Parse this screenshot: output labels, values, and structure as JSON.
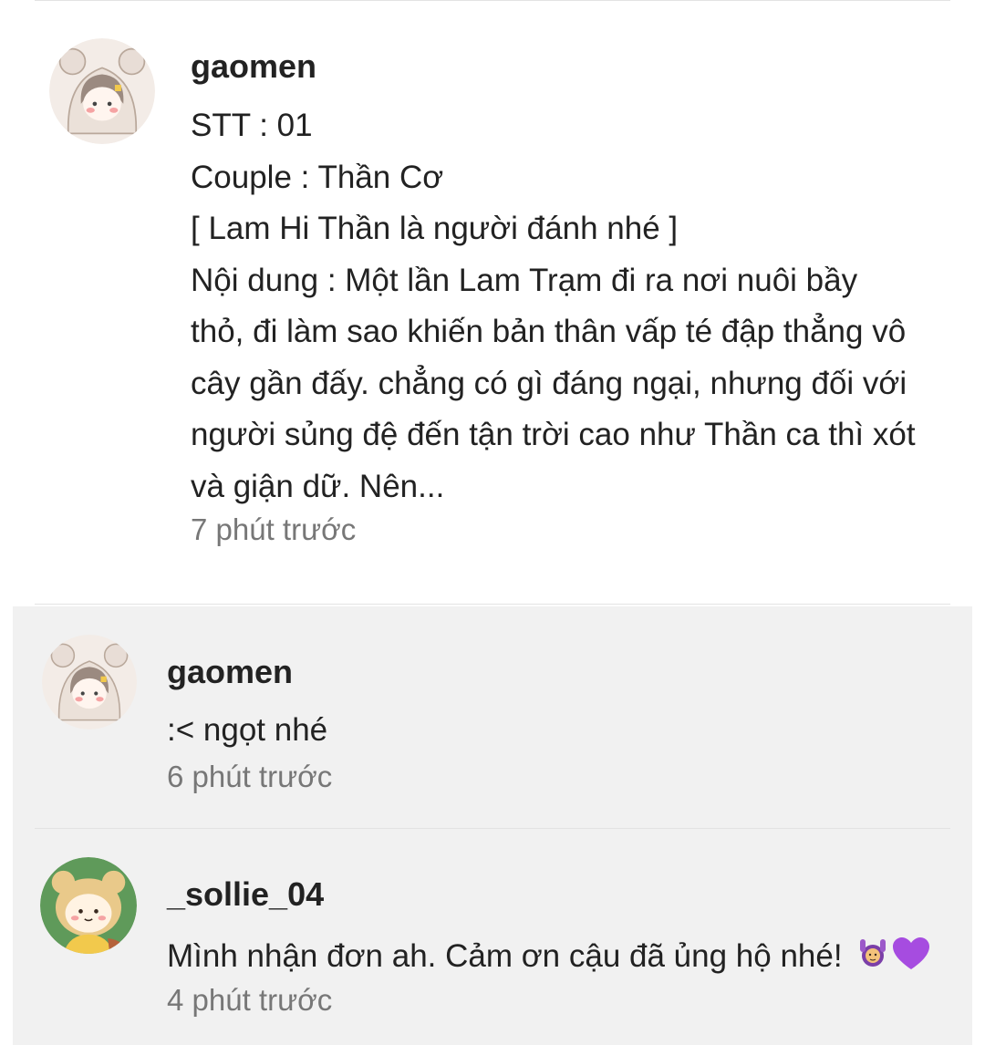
{
  "post": {
    "username": "gaomen",
    "lines": [
      "STT : 01",
      "Couple : Thần Cơ",
      "[ Lam Hi Thần là người đánh nhé ]",
      "Nội dung : Một lần Lam Trạm đi ra nơi nuôi bầy",
      "thỏ, đi làm sao khiến bản thân vấp té đập thẳng vô",
      "cây gần đấy. chẳng có gì đáng ngại, nhưng đối với",
      "người sủng đệ đến tận trời cao như Thần ca thì xót",
      "và giận dữ. Nên..."
    ],
    "time": "7 phút trước"
  },
  "replies": [
    {
      "username": "gaomen",
      "text": ":< ngọt nhé",
      "time": "6 phút trước"
    },
    {
      "username": "_sollie_04",
      "text": "Mình nhận đơn ah. Cảm ơn cậu đã ủng hộ nhé!",
      "time": "4 phút trước"
    }
  ],
  "colors": {
    "text": "#222222",
    "muted": "#777777",
    "reply_bg": "#f1f1f1",
    "divider": "#e3e3e3",
    "heart": "#a64ce0"
  },
  "icons": {
    "reply2_emoji": [
      "woman-raising-hands-icon",
      "purple-heart-icon"
    ]
  }
}
